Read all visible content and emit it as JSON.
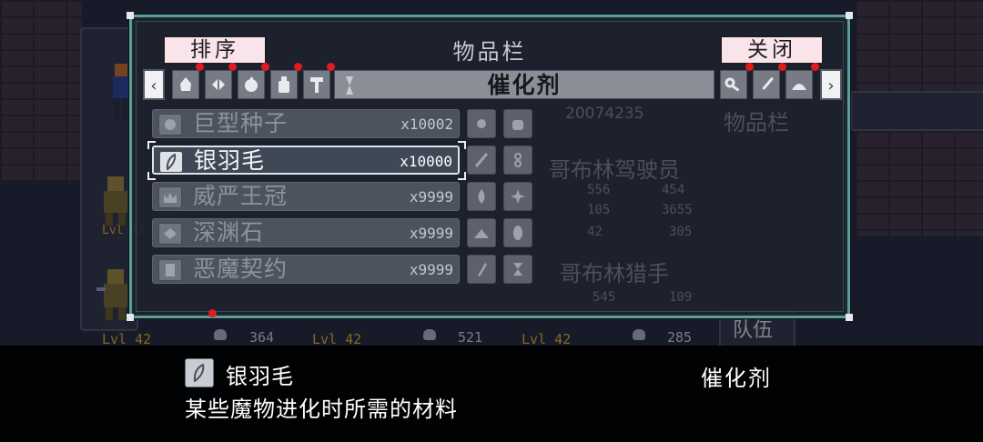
{
  "panel": {
    "title": "物品栏",
    "sort_button": "排序",
    "close_button": "关闭"
  },
  "tabs": {
    "left_arrow": "‹",
    "right_arrow": "›",
    "left_icons": [
      "stone-icon",
      "wing-icon",
      "orb-icon",
      "bottle-icon",
      "hammer-icon"
    ],
    "right_icons": [
      "key-icon",
      "sword-icon",
      "helmet-icon"
    ],
    "active_category": "催化剂"
  },
  "items": [
    {
      "name": "巨型种子",
      "count": "x10002",
      "icon": "seed-icon",
      "selected": false
    },
    {
      "name": "银羽毛",
      "count": "x10000",
      "icon": "feather-icon",
      "selected": true
    },
    {
      "name": "威严王冠",
      "count": "x9999",
      "icon": "crown-icon",
      "selected": false
    },
    {
      "name": "深渊石",
      "count": "x9999",
      "icon": "abyss-stone-icon",
      "selected": false
    },
    {
      "name": "恶魔契约",
      "count": "x9999",
      "icon": "contract-icon",
      "selected": false
    }
  ],
  "background": {
    "panel_title": "物品栏",
    "unit_name_1": "哥布林驾驶员",
    "unit_name_2": "哥布林猎手",
    "score": "20074235",
    "stats_1": [
      "556",
      "454",
      "105",
      "3655",
      "42",
      "305"
    ],
    "stats_2": [
      "545",
      "109"
    ],
    "team_label": "队伍",
    "levels": [
      "Lvl 42",
      "Lvl 42",
      "Lvl 42",
      "Lvl 42"
    ],
    "counts": [
      "364",
      "521",
      "285"
    ]
  },
  "description": {
    "item_name": "银羽毛",
    "category": "催化剂",
    "text": "某些魔物进化时所需的材料"
  },
  "colors": {
    "panel_border": "#5b9d9a",
    "button_pink": "#f9e4ea",
    "notification_red": "#e01b1b",
    "level_gold": "#c99a24"
  }
}
